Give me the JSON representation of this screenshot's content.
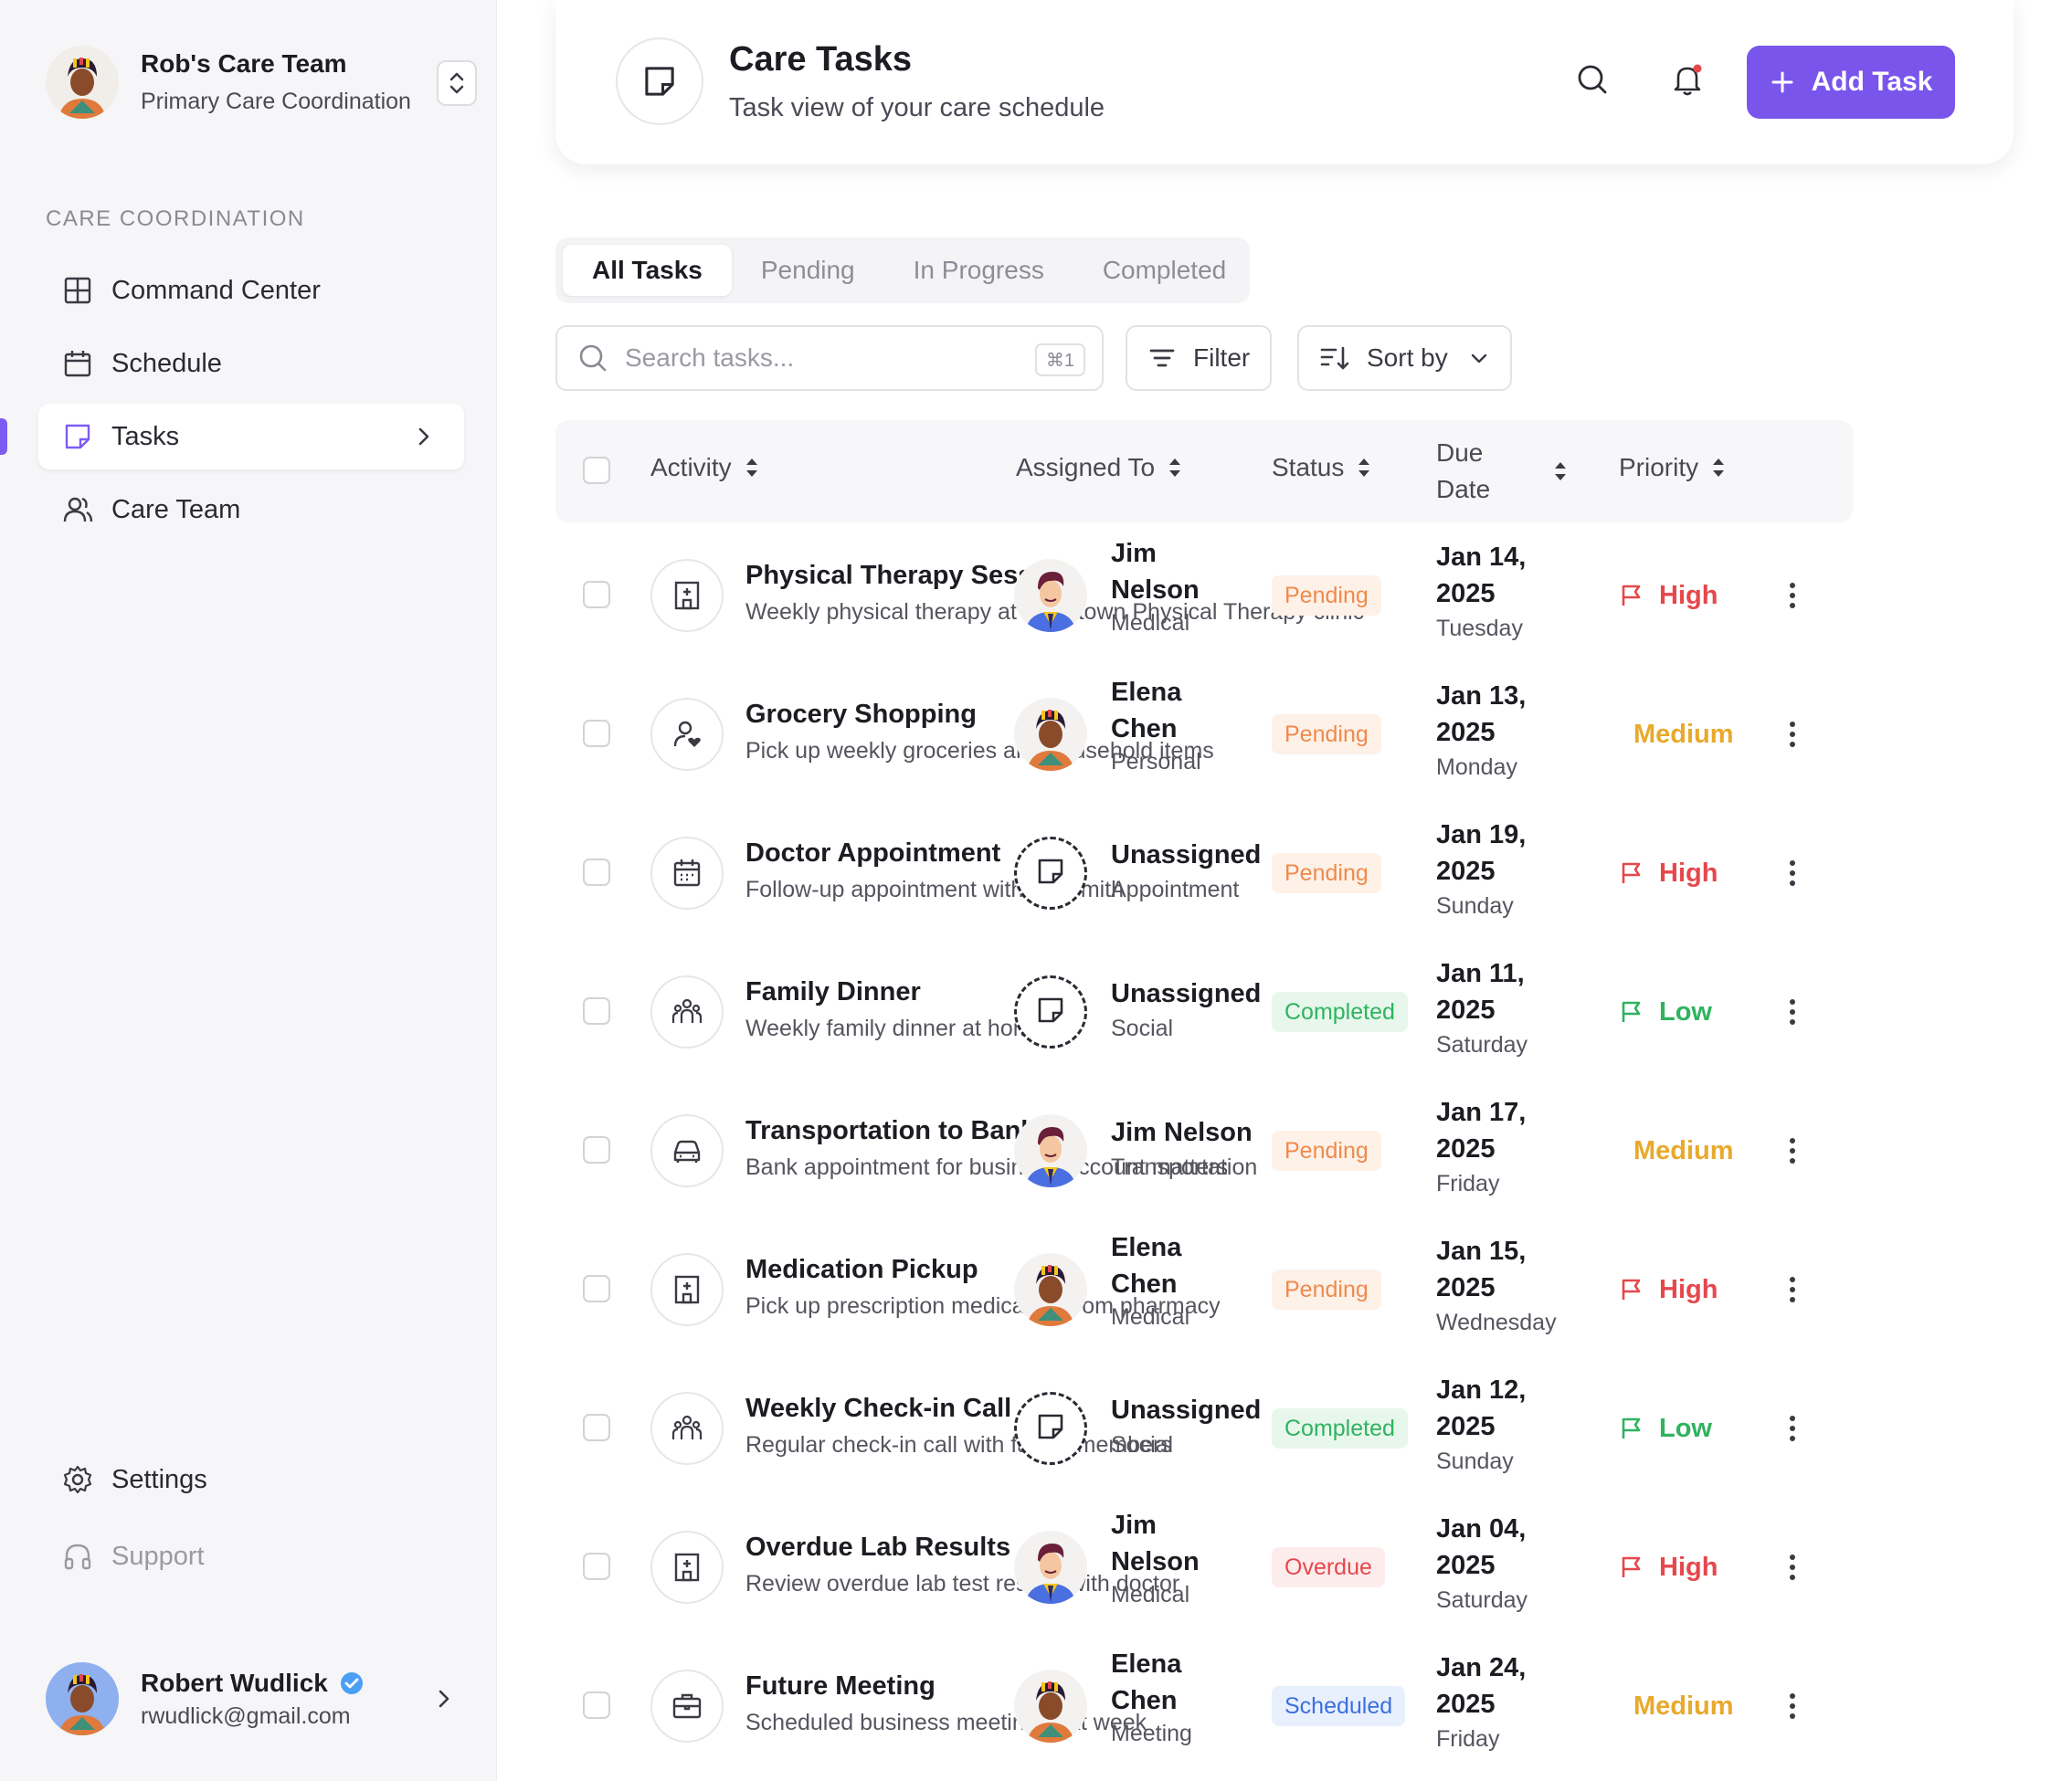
{
  "sidebar": {
    "team_name": "Rob's Care Team",
    "team_subtitle": "Primary Care Coordination",
    "section_label": "CARE COORDINATION",
    "nav": [
      {
        "label": "Command Center",
        "icon": "grid-icon"
      },
      {
        "label": "Schedule",
        "icon": "calendar-icon"
      },
      {
        "label": "Tasks",
        "icon": "sticky-note-icon",
        "active": true
      },
      {
        "label": "Care Team",
        "icon": "users-icon"
      }
    ],
    "settings_label": "Settings",
    "support_label": "Support",
    "user": {
      "name": "Robert Wudlick",
      "email": "rwudlick@gmail.com",
      "verified": true
    }
  },
  "header": {
    "title": "Care Tasks",
    "subtitle": "Task view of your care schedule",
    "add_button_label": "Add Task"
  },
  "tabs": [
    {
      "label": "All Tasks",
      "active": true
    },
    {
      "label": "Pending"
    },
    {
      "label": "In Progress"
    },
    {
      "label": "Completed"
    }
  ],
  "toolbar": {
    "search_placeholder": "Search tasks...",
    "search_shortcut": "⌘1",
    "filter_label": "Filter",
    "sort_label": "Sort by"
  },
  "table": {
    "columns": {
      "activity": "Activity",
      "assigned_to": "Assigned To",
      "status": "Status",
      "due_date": "Due Date",
      "priority": "Priority"
    },
    "rows": [
      {
        "icon": "hospital-icon",
        "title": "Physical Therapy Sess",
        "description": "Weekly physical therapy at downtown Physical Therapy clinic",
        "assignee": "Jim Nelson",
        "avatar": "male",
        "category": "Medical",
        "status": "Pending",
        "date": "Jan 14, 2025",
        "day": "Tuesday",
        "priority": "High",
        "flag": true
      },
      {
        "icon": "user-heart-icon",
        "title": "Grocery Shopping",
        "description": "Pick up weekly groceries and household items",
        "assignee": "Elena Chen",
        "avatar": "female",
        "category": "Personal",
        "status": "Pending",
        "date": "Jan 13, 2025",
        "day": "Monday",
        "priority": "Medium",
        "flag": false
      },
      {
        "icon": "calendar-icon",
        "title": "Doctor Appointment",
        "description": "Follow-up appointment with Dr. Smith",
        "assignee": "Unassigned",
        "avatar": "none",
        "category": "Appointment",
        "status": "Pending",
        "date": "Jan 19, 2025",
        "day": "Sunday",
        "priority": "High",
        "flag": true
      },
      {
        "icon": "people-icon",
        "title": "Family Dinner",
        "description": "Weekly family dinner at home",
        "assignee": "Unassigned",
        "avatar": "none",
        "category": "Social",
        "status": "Completed",
        "date": "Jan 11, 2025",
        "day": "Saturday",
        "priority": "Low",
        "flag": true
      },
      {
        "icon": "car-icon",
        "title": "Transportation to Bank",
        "description": "Bank appointment for business account matters",
        "assignee": "Jim Nelson",
        "avatar": "male",
        "category": "Transportation",
        "status": "Pending",
        "date": "Jan 17, 2025",
        "day": "Friday",
        "priority": "Medium",
        "flag": false
      },
      {
        "icon": "hospital-icon",
        "title": "Medication Pickup",
        "description": "Pick up prescription medication from pharmacy",
        "assignee": "Elena Chen",
        "avatar": "female",
        "category": "Medical",
        "status": "Pending",
        "date": "Jan 15, 2025",
        "day": "Wednesday",
        "priority": "High",
        "flag": true
      },
      {
        "icon": "people-icon",
        "title": "Weekly Check-in Call",
        "description": "Regular check-in call with family members",
        "assignee": "Unassigned",
        "avatar": "none",
        "category": "Social",
        "status": "Completed",
        "date": "Jan 12, 2025",
        "day": "Sunday",
        "priority": "Low",
        "flag": true
      },
      {
        "icon": "hospital-icon",
        "title": "Overdue Lab Results",
        "description": "Review overdue lab test results with doctor",
        "assignee": "Jim Nelson",
        "avatar": "male",
        "category": "Medical",
        "status": "Overdue",
        "date": "Jan 04, 2025",
        "day": "Saturday",
        "priority": "High",
        "flag": true
      },
      {
        "icon": "briefcase-icon",
        "title": "Future Meeting",
        "description": "Scheduled business meeting next week",
        "assignee": "Elena Chen",
        "avatar": "female",
        "category": "Meeting",
        "status": "Scheduled",
        "date": "Jan 24, 2025",
        "day": "Friday",
        "priority": "Medium",
        "flag": false
      }
    ]
  },
  "colors": {
    "accent": "#7a55ec",
    "status_pending_bg": "#fdf1e8",
    "status_pending_fg": "#f08a4b",
    "status_completed_bg": "#e7f7ec",
    "status_completed_fg": "#2fb35f",
    "status_overdue_bg": "#fdecec",
    "status_overdue_fg": "#e5484d",
    "status_scheduled_bg": "#e9f0fd",
    "status_scheduled_fg": "#3b6fe0",
    "priority_high": "#e5484d",
    "priority_medium": "#e8a92c",
    "priority_low": "#2fb35f"
  }
}
